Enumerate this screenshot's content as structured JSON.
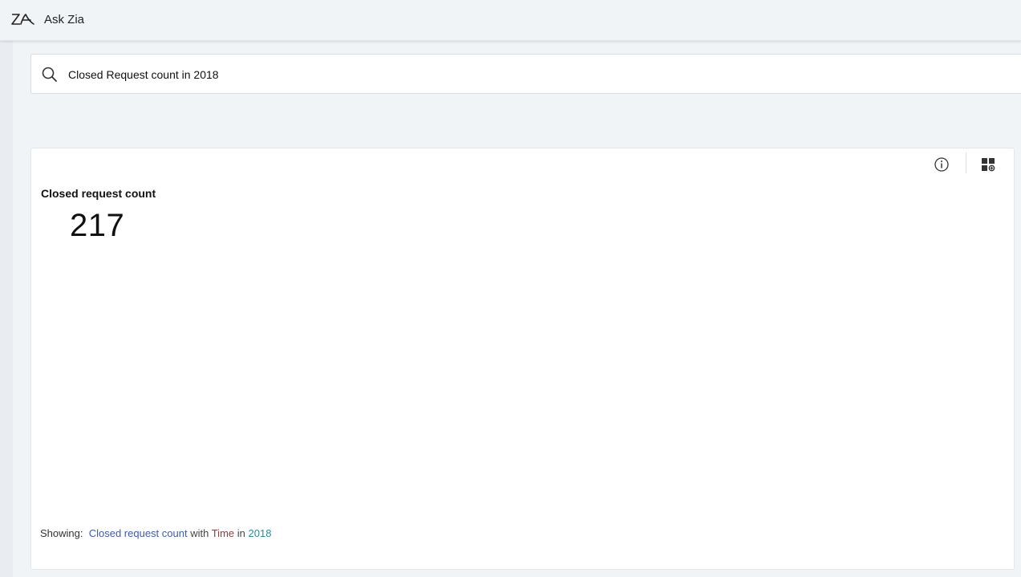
{
  "app": {
    "title": "Ask Zia",
    "logo_icon": "zia-logo-icon"
  },
  "search": {
    "query": "Closed Request count in 2018"
  },
  "result_card": {
    "title": "Closed request count",
    "value": "217",
    "actions": {
      "info_icon": "info-icon",
      "add_to_dashboard_icon": "add-widget-icon"
    },
    "footer": {
      "prefix": "Showing:",
      "measure": "Closed request count",
      "with_word": "with",
      "dimension": "Time",
      "in_word": "in",
      "filter_value": "2018"
    }
  },
  "colors": {
    "measure": "#3d5bb5",
    "dimension": "#8a3f3f",
    "filter": "#2f8a9a",
    "background": "#f1f4f7"
  }
}
